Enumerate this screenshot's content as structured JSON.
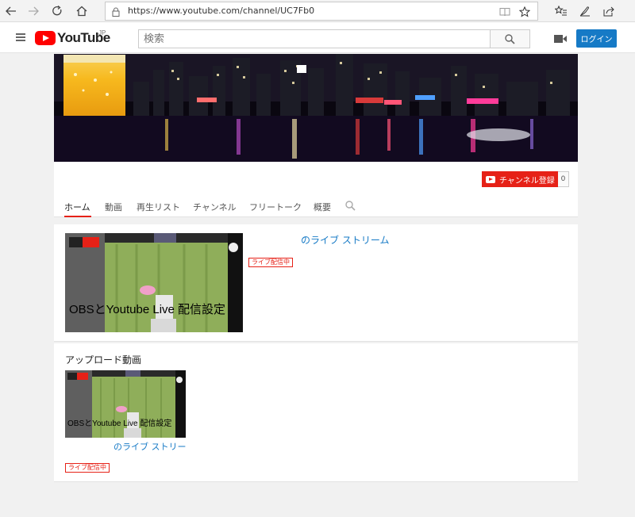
{
  "browser": {
    "url": "https://www.youtube.com/channel/UC7Fb0",
    "icons": [
      "back-icon",
      "forward-icon",
      "refresh-icon",
      "home-icon",
      "lock-icon",
      "reading-view-icon",
      "favorite-star-icon",
      "favorites-list-icon",
      "pen-icon",
      "share-icon"
    ]
  },
  "header": {
    "logo_text": "YouTube",
    "region": "JP",
    "search_placeholder": "検索",
    "login_label": "ログイン"
  },
  "channel": {
    "subscribe_label": "チャンネル登録",
    "subscriber_count": "0",
    "tabs": [
      "ホーム",
      "動画",
      "再生リスト",
      "チャンネル",
      "フリートーク",
      "概要"
    ],
    "active_tab": "ホーム"
  },
  "featured": {
    "title": "のライブ ストリーム",
    "badge": "ライブ配信中",
    "thumb_caption": "OBSとYoutube Live 配信設定",
    "thumb_logo": "YouTube",
    "thumb_bubble": "ﾗｲﾌﾞ"
  },
  "uploads": {
    "section_title": "アップロード動画",
    "video_title": "のライブ ストリー",
    "badge": "ライブ配信中",
    "thumb_caption": "OBSとYoutube Live 配信設定"
  },
  "colors": {
    "accent_red": "#e62117",
    "link_blue": "#167ac6",
    "login_blue": "#167ac6"
  }
}
